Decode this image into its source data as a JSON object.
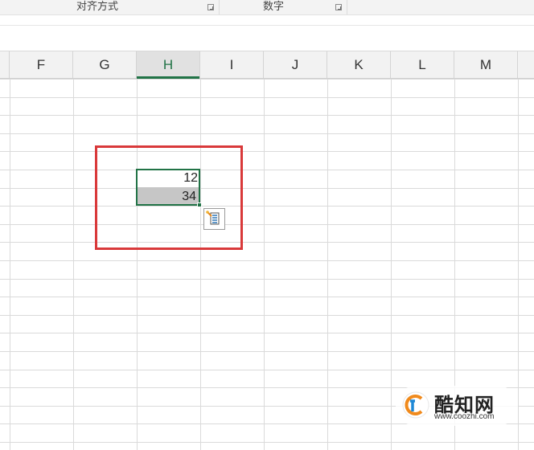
{
  "ribbon": {
    "groups": [
      {
        "label": "对齐方式"
      },
      {
        "label": "数字"
      }
    ]
  },
  "columns": [
    "F",
    "G",
    "H",
    "I",
    "J",
    "K",
    "L",
    "M"
  ],
  "active_column": "H",
  "cells": {
    "H_row1": "12",
    "H_row2": "34"
  },
  "watermark": {
    "title": "酷知网",
    "url": "www.coozhi.com"
  },
  "colors": {
    "accent_green": "#217346",
    "annotation_red": "#d9393a",
    "highlight_gray": "#c6c6c6"
  },
  "icons": [
    "dialog-launcher-icon",
    "autofill-options-icon",
    "coozhi-logo-icon"
  ]
}
